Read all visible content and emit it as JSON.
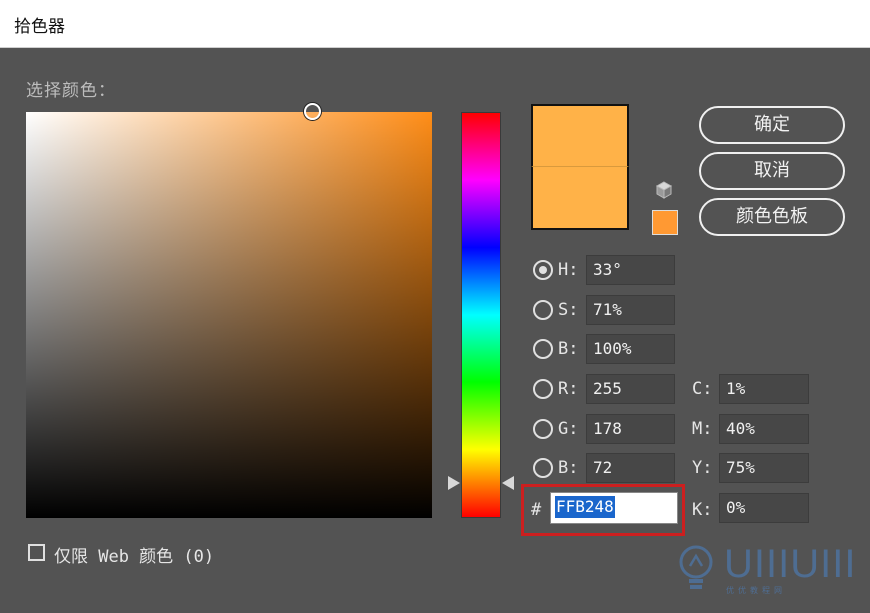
{
  "window": {
    "title": "拾色器"
  },
  "picker": {
    "label": "选择颜色："
  },
  "buttons": {
    "ok": "确定",
    "cancel": "取消",
    "swatches": "颜色色板"
  },
  "hsb": [
    {
      "label": "H:",
      "value": "33°",
      "checked": true
    },
    {
      "label": "S:",
      "value": "71%",
      "checked": false
    },
    {
      "label": "B:",
      "value": "100%",
      "checked": false
    }
  ],
  "rgb": [
    {
      "label": "R:",
      "value": "255"
    },
    {
      "label": "G:",
      "value": "178"
    },
    {
      "label": "B:",
      "value": "72"
    }
  ],
  "cmyk": [
    {
      "label": "C:",
      "value": "1%"
    },
    {
      "label": "M:",
      "value": "40%"
    },
    {
      "label": "Y:",
      "value": "75%"
    },
    {
      "label": "K:",
      "value": "0%"
    }
  ],
  "hex": {
    "prefix": "#",
    "value": "FFB248"
  },
  "web_only": {
    "label": "仅限 Web 颜色 (0)"
  },
  "watermark": {
    "text": "UIIIUIII",
    "sub": "优优教程网"
  },
  "colors": {
    "current": "#ffb248",
    "websafe": "#ff9933",
    "hue": "#ff8d17",
    "highlight": "#cc1f1f"
  }
}
